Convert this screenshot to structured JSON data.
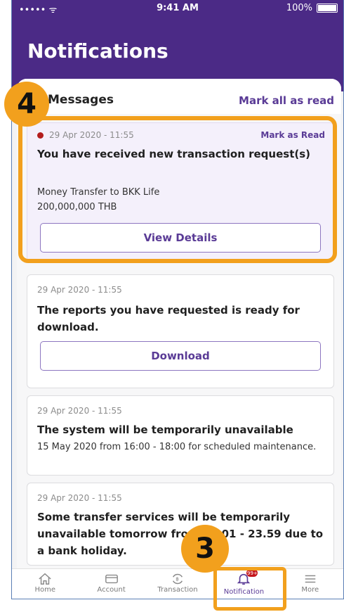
{
  "status_bar": {
    "signal": "••••• ᯤ",
    "time": "9:41 AM",
    "battery": "100%"
  },
  "header": {
    "title": "Notifications"
  },
  "panel": {
    "section_title": "Messages",
    "mark_all_label": "Mark all as read"
  },
  "notifications": [
    {
      "date": "29 Apr 2020 - 11:55",
      "mark_read_label": "Mark as Read",
      "title": "You have received new transaction request(s)",
      "body_line1": "Money Transfer to BKK Life",
      "body_line2": "200,000,000 THB",
      "button_label": "View Details",
      "unread": true
    },
    {
      "date": "29 Apr 2020 - 11:55",
      "title": "The reports you have requested is ready for download.",
      "button_label": "Download"
    },
    {
      "date": "29 Apr 2020 - 11:55",
      "title": "The system will be temporarily unavailable",
      "body": "15 May 2020 from 16:00 - 18:00 for scheduled maintenance."
    },
    {
      "date": "29 Apr 2020 - 11:55",
      "title": "Some transfer services will be temporarily unavailable tomorrow from 00:01 - 23.59 due to a bank holiday."
    }
  ],
  "annotations": {
    "step_a": "4",
    "step_b": "3",
    "highlight_color": "#f2a01d"
  },
  "tab_bar": {
    "tabs": [
      {
        "label": "Home",
        "icon": "home-icon"
      },
      {
        "label": "Account",
        "icon": "card-icon"
      },
      {
        "label": "Transaction",
        "icon": "transfer-icon"
      },
      {
        "label": "Notification",
        "icon": "bell-icon",
        "badge": "99+",
        "active": true
      },
      {
        "label": "More",
        "icon": "menu-icon"
      }
    ]
  },
  "colors": {
    "brand_purple": "#4b2a86",
    "accent_text": "#5a3b96",
    "unread_dot": "#b31d1d"
  }
}
